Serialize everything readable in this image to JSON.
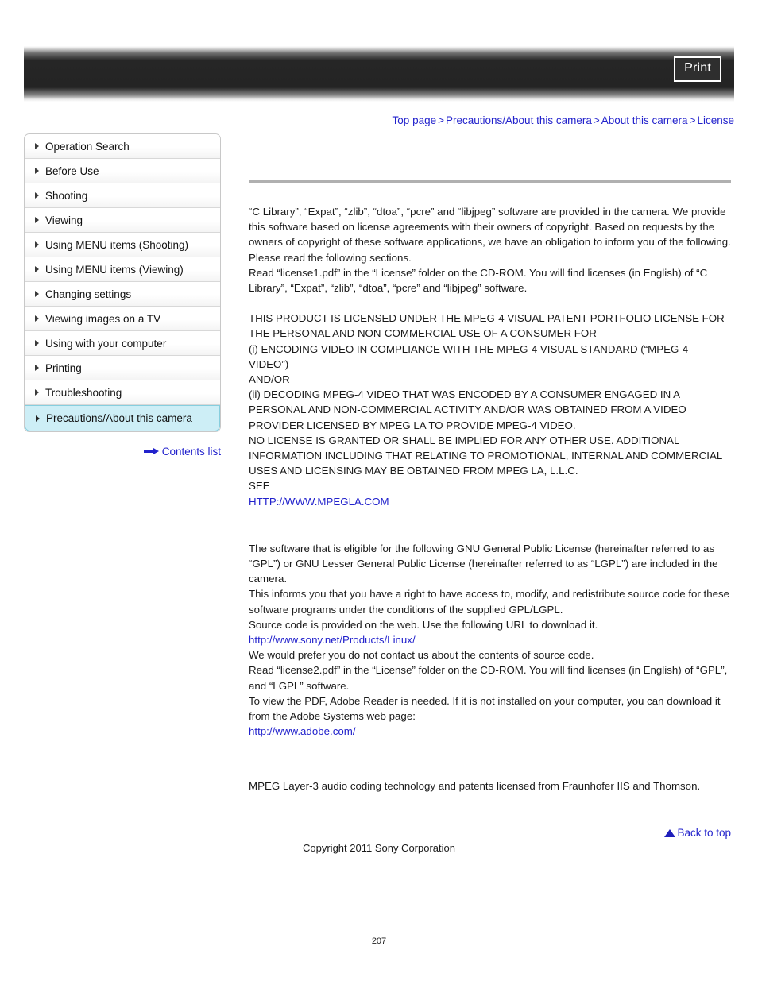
{
  "header": {
    "print_label": "Print"
  },
  "breadcrumb": {
    "separator": ">",
    "items": [
      {
        "label": "Top page"
      },
      {
        "label": "Precautions/About this camera"
      },
      {
        "label": "About this camera"
      },
      {
        "label": "License"
      }
    ]
  },
  "sidebar": {
    "items": [
      {
        "label": "Operation Search",
        "active": false
      },
      {
        "label": "Before Use",
        "active": false
      },
      {
        "label": "Shooting",
        "active": false
      },
      {
        "label": "Viewing",
        "active": false
      },
      {
        "label": "Using MENU items (Shooting)",
        "active": false
      },
      {
        "label": "Using MENU items (Viewing)",
        "active": false
      },
      {
        "label": "Changing settings",
        "active": false
      },
      {
        "label": "Viewing images on a TV",
        "active": false
      },
      {
        "label": "Using with your computer",
        "active": false
      },
      {
        "label": "Printing",
        "active": false
      },
      {
        "label": "Troubleshooting",
        "active": false
      },
      {
        "label": "Precautions/About this camera",
        "active": true
      }
    ],
    "contents_list_label": "Contents list"
  },
  "content": {
    "license_paragraph": "“C Library”, “Expat”, “zlib”, “dtoa”, “pcre” and “libjpeg” software are provided in the camera. We provide this software based on license agreements with their owners of copyright. Based on requests by the owners of copyright of these software applications, we have an obligation to inform you of the following. Please read the following sections.\nRead “license1.pdf” in the “License” folder on the CD-ROM. You will find licenses (in English) of “C Library”, “Expat”, “zlib”, “dtoa”, “pcre” and “libjpeg” software.",
    "mpeg4_paragraph": "THIS PRODUCT IS LICENSED UNDER THE MPEG-4 VISUAL PATENT PORTFOLIO LICENSE FOR THE PERSONAL AND NON-COMMERCIAL USE OF A CONSUMER FOR\n(i) ENCODING VIDEO IN COMPLIANCE WITH THE MPEG-4 VISUAL STANDARD (“MPEG-4 VIDEO”)\nAND/OR\n(ii) DECODING MPEG-4 VIDEO THAT WAS ENCODED BY A CONSUMER ENGAGED IN A PERSONAL AND NON-COMMERCIAL ACTIVITY AND/OR WAS OBTAINED FROM A VIDEO PROVIDER LICENSED BY MPEG LA TO PROVIDE MPEG-4 VIDEO.\nNO LICENSE IS GRANTED OR SHALL BE IMPLIED FOR ANY OTHER USE. ADDITIONAL INFORMATION INCLUDING THAT RELATING TO PROMOTIONAL, INTERNAL AND COMMERCIAL USES AND LICENSING MAY BE OBTAINED FROM MPEG LA, L.L.C.\nSEE",
    "mpegla_link": "HTTP://WWW.MPEGLA.COM",
    "gpl_paragraph_1": "The software that is eligible for the following GNU General Public License (hereinafter referred to as “GPL”) or GNU Lesser General Public License (hereinafter referred to as “LGPL”) are included in the camera.\nThis informs you that you have a right to have access to, modify, and redistribute source code for these software programs under the conditions of the supplied GPL/LGPL.\nSource code is provided on the web. Use the following URL to download it.",
    "sony_linux_link": "http://www.sony.net/Products/Linux/",
    "gpl_paragraph_2": "We would prefer you do not contact us about the contents of source code.\nRead “license2.pdf” in the “License” folder on the CD-ROM. You will find licenses (in English) of “GPL”, and “LGPL” software.\nTo view the PDF, Adobe Reader is needed. If it is not installed on your computer, you can download it from the Adobe Systems web page:",
    "adobe_link": "http://www.adobe.com/",
    "mp3_paragraph": "MPEG Layer-3 audio coding technology and patents licensed from Fraunhofer IIS and Thomson."
  },
  "footer": {
    "back_to_top_label": "Back to top",
    "copyright": "Copyright 2011 Sony Corporation",
    "page_number": "207"
  },
  "colors": {
    "link": "#2222cc",
    "active_nav_bg": "#cdeef6",
    "active_nav_border": "#86cede",
    "rule": "#b0b0b0"
  }
}
